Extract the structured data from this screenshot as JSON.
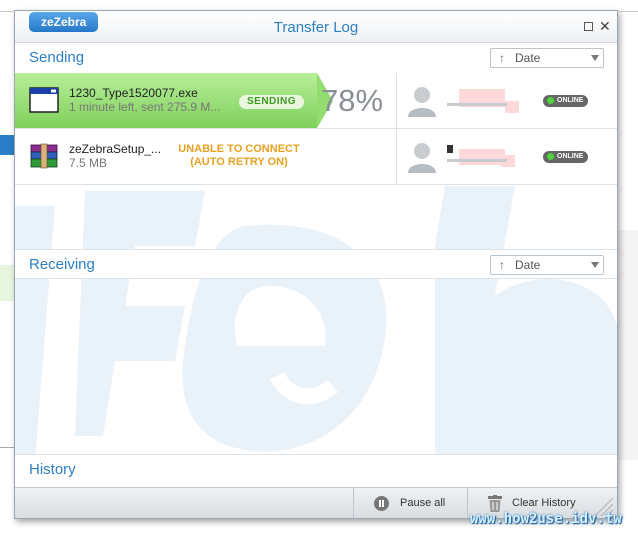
{
  "window": {
    "brand": "zeZebra",
    "title": "Transfer Log"
  },
  "sending": {
    "title": "Sending",
    "sort_label": "Date",
    "rows": [
      {
        "file_name": "1230_Type1520077.exe",
        "sub": "1 minute left, sent 275.9 M...",
        "status": "SENDING",
        "progress_percent": 78,
        "percent_label": "78%",
        "user_status": "ONLINE"
      },
      {
        "file_name": "zeZebraSetup_...",
        "sub": "7.5 MB",
        "status_line1": "UNABLE TO CONNECT",
        "status_line2": "(AUTO RETRY ON)",
        "user_status": "ONLINE"
      }
    ]
  },
  "receiving": {
    "title": "Receiving",
    "sort_label": "Date"
  },
  "history": {
    "title": "History"
  },
  "footer": {
    "pause_label": "Pause all",
    "clear_label": "Clear History"
  },
  "site_watermark": "www.how2use.idv.tw",
  "colors": {
    "accent": "#2d7fc1",
    "progress": "#8fdc68",
    "error": "#e8a020",
    "online": "#4ed33a"
  }
}
